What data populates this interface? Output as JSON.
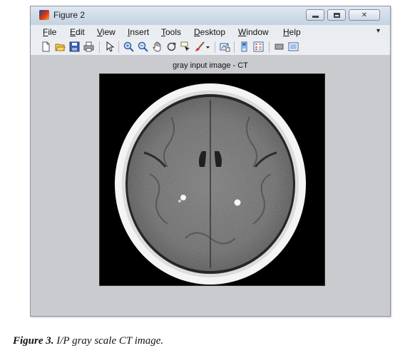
{
  "window": {
    "title": "Figure 2"
  },
  "menu": {
    "items": [
      {
        "label": "File",
        "underline": "F"
      },
      {
        "label": "Edit",
        "underline": "E"
      },
      {
        "label": "View",
        "underline": "V"
      },
      {
        "label": "Insert",
        "underline": "I"
      },
      {
        "label": "Tools",
        "underline": "T"
      },
      {
        "label": "Desktop",
        "underline": "D"
      },
      {
        "label": "Window",
        "underline": "W"
      },
      {
        "label": "Help",
        "underline": "H"
      }
    ],
    "overflow_arrow": "▾"
  },
  "toolbar": {
    "buttons": [
      "new-figure-icon",
      "open-file-icon",
      "save-icon",
      "print-icon",
      "select-arrow-icon",
      "zoom-in-icon",
      "zoom-out-icon",
      "pan-hand-icon",
      "rotate-3d-icon",
      "data-cursor-icon",
      "brush-icon",
      "brush-dropdown-icon",
      "link-plot-icon",
      "colorbar-icon",
      "legend-icon",
      "hide-plot-tools-icon",
      "show-plot-tools-icon"
    ]
  },
  "axes": {
    "title": "gray input image - CT"
  },
  "caption": {
    "label": "Figure 3.",
    "text": " I/P gray scale CT image."
  }
}
